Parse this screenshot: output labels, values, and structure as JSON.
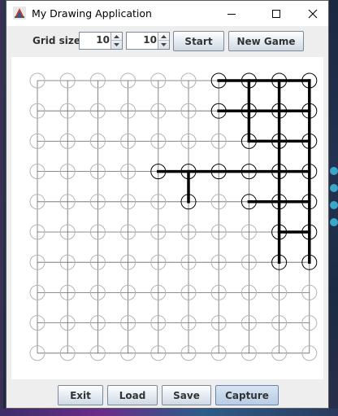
{
  "window": {
    "title": "My Drawing Application"
  },
  "toolbar": {
    "grid_size_label": "Grid size:",
    "grid_rows": "10",
    "grid_cols": "10",
    "start_label": "Start",
    "new_game_label": "New Game"
  },
  "bottom": {
    "exit_label": "Exit",
    "load_label": "Load",
    "save_label": "Save",
    "capture_label": "Capture"
  },
  "board": {
    "rows": 10,
    "cols": 10,
    "active_nodes": [
      [
        0,
        6
      ],
      [
        0,
        7
      ],
      [
        0,
        8
      ],
      [
        0,
        9
      ],
      [
        1,
        6
      ],
      [
        1,
        7
      ],
      [
        1,
        8
      ],
      [
        1,
        9
      ],
      [
        2,
        7
      ],
      [
        2,
        8
      ],
      [
        2,
        9
      ],
      [
        3,
        4
      ],
      [
        3,
        5
      ],
      [
        3,
        6
      ],
      [
        3,
        7
      ],
      [
        3,
        8
      ],
      [
        3,
        9
      ],
      [
        4,
        5
      ],
      [
        4,
        7
      ],
      [
        4,
        8
      ],
      [
        4,
        9
      ],
      [
        5,
        8
      ],
      [
        5,
        9
      ],
      [
        6,
        8
      ],
      [
        6,
        9
      ]
    ],
    "drawn_segments": [
      [
        [
          0,
          6
        ],
        [
          0,
          9
        ]
      ],
      [
        [
          0,
          7
        ],
        [
          2,
          7
        ]
      ],
      [
        [
          0,
          8
        ],
        [
          6,
          8
        ]
      ],
      [
        [
          0,
          9
        ],
        [
          6,
          9
        ]
      ],
      [
        [
          1,
          6
        ],
        [
          1,
          9
        ]
      ],
      [
        [
          2,
          7
        ],
        [
          2,
          9
        ]
      ],
      [
        [
          3,
          4
        ],
        [
          3,
          9
        ]
      ],
      [
        [
          3,
          5
        ],
        [
          4,
          5
        ]
      ],
      [
        [
          4,
          7
        ],
        [
          4,
          9
        ]
      ],
      [
        [
          5,
          8
        ],
        [
          5,
          9
        ]
      ]
    ]
  }
}
